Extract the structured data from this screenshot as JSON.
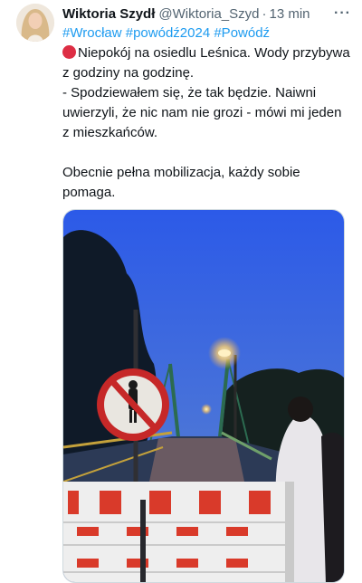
{
  "tweet": {
    "author_name": "Wiktoria Szydł",
    "handle": "@Wiktoria_Szyd",
    "separator": "·",
    "time": "13 min",
    "more_icon": "more-horizontal-icon",
    "hashtags": [
      "#Wrocław",
      "#powódź2024",
      "#Powódź"
    ],
    "line_1": "Niepokój na osiedlu Leśnica. Wody przybywa z godziny na godzinę.",
    "line_2": "- Spodziewałem się, że tak będzie. Naiwni uwierzyli, że nic nam nie grozi - mówi mi jeden z mieszkańców.",
    "line_3": "Obecnie pełna mobilizacja, każdy sobie pomaga.",
    "status_emoji": "red-circle-icon"
  },
  "colors": {
    "link": "#1d9bf0",
    "text": "#0f1419",
    "muted": "#536471",
    "emoji_red": "#dd2e44"
  }
}
